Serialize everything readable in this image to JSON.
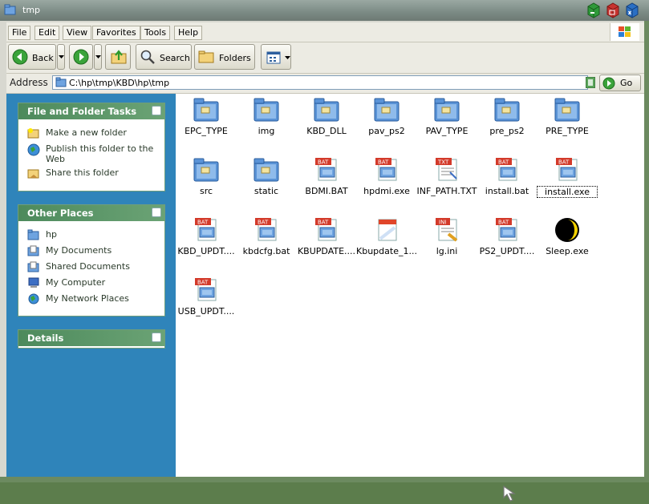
{
  "window": {
    "title": "tmp"
  },
  "menu": [
    "File",
    "Edit",
    "View",
    "Favorites",
    "Tools",
    "Help"
  ],
  "toolbar": {
    "back_label": "Back",
    "search_label": "Search",
    "folders_label": "Folders"
  },
  "address": {
    "label": "Address",
    "value": "C:\\hp\\tmp\\KBD\\hp\\tmp",
    "go_label": "Go"
  },
  "tasks_panel": {
    "title": "File and Folder Tasks",
    "items": [
      "Make a new folder",
      "Publish this folder to the Web",
      "Share this folder"
    ]
  },
  "places_panel": {
    "title": "Other Places",
    "items": [
      "hp",
      "My Documents",
      "Shared Documents",
      "My Computer",
      "My Network Places"
    ]
  },
  "details_panel": {
    "title": "Details"
  },
  "files": [
    {
      "name": "EPC_TYPE",
      "icon": "folder-icon"
    },
    {
      "name": "img",
      "icon": "folder-icon"
    },
    {
      "name": "KBD_DLL",
      "icon": "folder-icon"
    },
    {
      "name": "pav_ps2",
      "icon": "folder-icon"
    },
    {
      "name": "PAV_TYPE",
      "icon": "folder-icon"
    },
    {
      "name": "pre_ps2",
      "icon": "folder-icon"
    },
    {
      "name": "PRE_TYPE",
      "icon": "folder-icon"
    },
    {
      "name": "src",
      "icon": "folder-icon"
    },
    {
      "name": "static",
      "icon": "folder-icon"
    },
    {
      "name": "BDMI.BAT",
      "icon": "batch-file-icon"
    },
    {
      "name": "hpdmi.exe",
      "icon": "batch-file-icon"
    },
    {
      "name": "INF_PATH.TXT",
      "icon": "text-file-icon"
    },
    {
      "name": "install.bat",
      "icon": "batch-file-icon"
    },
    {
      "name": "install.exe",
      "icon": "batch-file-icon"
    },
    {
      "name": "KBD_UPDT....",
      "icon": "batch-file-icon"
    },
    {
      "name": "kbdcfg.bat",
      "icon": "batch-file-icon"
    },
    {
      "name": "KBUPDATE....",
      "icon": "batch-file-icon"
    },
    {
      "name": "Kbupdate_1...",
      "icon": "document-icon"
    },
    {
      "name": "lg.ini",
      "icon": "ini-file-icon"
    },
    {
      "name": "PS2_UPDT....",
      "icon": "batch-file-icon"
    },
    {
      "name": "Sleep.exe",
      "icon": "moon-app-icon"
    },
    {
      "name": "USB_UPDT....",
      "icon": "batch-file-icon"
    }
  ],
  "colors": {
    "sidebar": "#2f84ba",
    "panel_header": "#5a9468",
    "title_bar": "#7b8a84"
  }
}
